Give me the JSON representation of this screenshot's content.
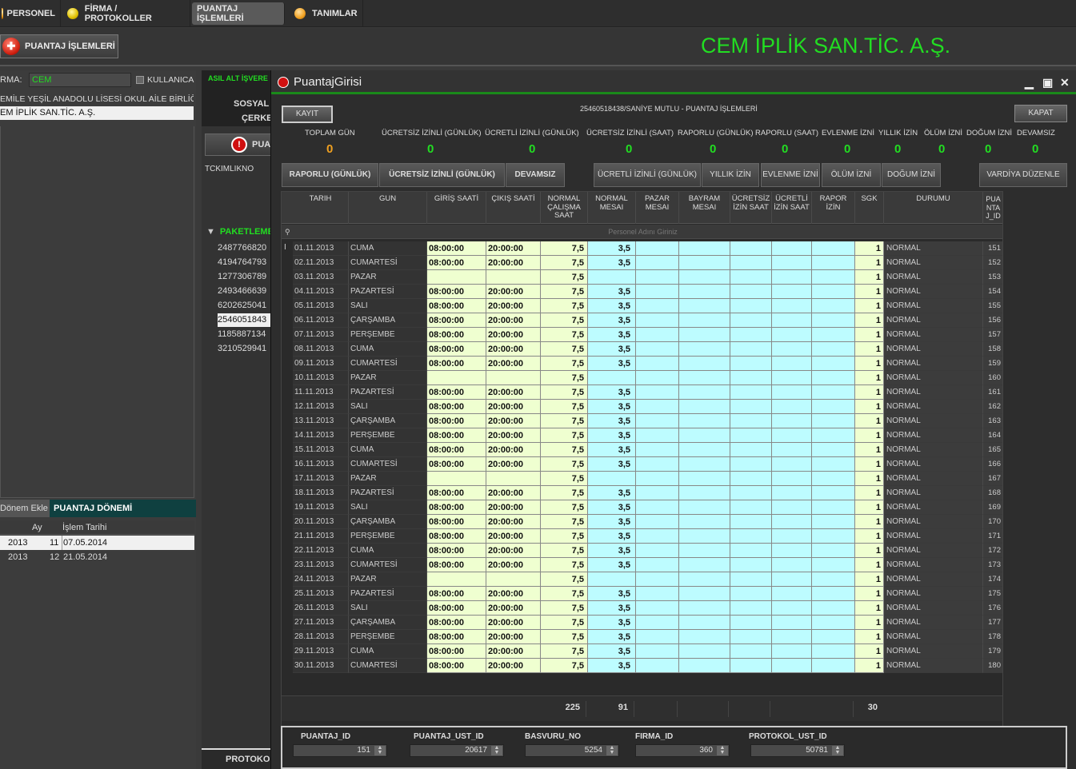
{
  "topbar": {
    "tabs": [
      {
        "label": "PERSONEL",
        "icon": "orange-dot-icon"
      },
      {
        "label": "FİRMA / PROTOKOLLER",
        "icon": "yellow-dot-icon"
      },
      {
        "label": "PUANTAJ İŞLEMLERİ",
        "active": true
      },
      {
        "label": "TANIMLAR",
        "icon": "orange-dot-icon"
      }
    ]
  },
  "subbar": {
    "main_button": "PUANTAJ İŞLEMLERİ",
    "company": "CEM İPLİK SAN.TİC. A.Ş."
  },
  "left": {
    "firma_label": "RMA:",
    "firma_value": "CEM",
    "kullanici_label": "KULLANICA",
    "firms": [
      "EMİLE YEŞİL ANADOLU LİSESİ OKUL AİLE BİRLİĞİ E",
      "EM İPLİK SAN.TİC. A.Ş."
    ],
    "donem_ekle": "Dönem Ekle",
    "donem_title": "PUANTAJ DÖNEMİ",
    "donem_headers": [
      "Ay",
      "İşlem Tarihi"
    ],
    "donem_rows": [
      {
        "yil": "2013",
        "ay": "11",
        "tarih": "07.05.2014"
      },
      {
        "yil": "2013",
        "ay": "12",
        "tarih": "21.05.2014"
      }
    ]
  },
  "mid": {
    "asil": "ASIL ALT İŞVERE",
    "sosyal": "SOSYAL",
    "cerke": "ÇERKE",
    "pua": "PUA",
    "tckimlikno": "TCKIMLIKNO",
    "paket": "PAKETLEME",
    "tc_list": [
      "2487766820",
      "4194764793",
      "1277306789",
      "2493466639",
      "6202625041",
      "2546051843",
      "1185887134",
      "3210529941"
    ],
    "protoko": "PROTOKO"
  },
  "modal": {
    "title": "PuantajGirisi",
    "kayit": "KAYIT",
    "kapat": "KAPAT",
    "subtitle": "25460518438/SANİYE  MUTLU - PUANTAJ İŞLEMLERİ",
    "stats": [
      {
        "label": "TOPLAM GÜN",
        "value": "0"
      },
      {
        "label": "ÜCRETSİZ İZİNLİ (GÜNLÜK)",
        "value": "0"
      },
      {
        "label": "ÜCRETLİ İZİNLİ (GÜNLÜK)",
        "value": "0"
      },
      {
        "label": "ÜCRETSİZ İZİNLİ (SAAT)",
        "value": "0"
      },
      {
        "label": "RAPORLU (GÜNLÜK)",
        "value": "0"
      },
      {
        "label": "RAPORLU (SAAT)",
        "value": "0"
      },
      {
        "label": "EVLENME İZNİ",
        "value": "0"
      },
      {
        "label": "YILLIK İZİN",
        "value": "0"
      },
      {
        "label": "ÖLÜM İZNİ",
        "value": "0"
      },
      {
        "label": "DOĞUM İZNİ",
        "value": "0"
      },
      {
        "label": "DEVAMSIZ",
        "value": "0"
      }
    ],
    "actions": [
      "RAPORLU (GÜNLÜK)",
      "ÜCRETSİZ İZİNLİ (GÜNLÜK)",
      "DEVAMSIZ",
      "ÜCRETLİ İZİNLİ (GÜNLÜK)",
      "YILLIK İZİN",
      "EVLENME İZNİ",
      "ÖLÜM İZNİ",
      "DOĞUM İZNİ",
      "VARDİYA DÜZENLE"
    ],
    "grid": {
      "headers": [
        "TARIH",
        "GUN",
        "GİRİŞ SAATİ",
        "ÇIKIŞ SAATİ",
        "NORMAL ÇALIŞMA SAAT",
        "NORMAL MESAI",
        "PAZAR MESAI",
        "BAYRAM MESAI",
        "ÜCRETSİZ İZİN SAAT",
        "ÜCRETLİ İZİN SAAT",
        "RAPOR İZİN",
        "SGK",
        "DURUMU",
        "PUA NTA J_ID"
      ],
      "filter_placeholder": "Personel Adını Giriniz",
      "rows": [
        {
          "tarih": "01.11.2013",
          "gun": "CUMA",
          "giris": "08:00:00",
          "cikis": "20:00:00",
          "normal": "7,5",
          "mesai": "3,5",
          "sgk": "1",
          "durum": "NORMAL",
          "id": "151"
        },
        {
          "tarih": "02.11.2013",
          "gun": "CUMARTESİ",
          "giris": "08:00:00",
          "cikis": "20:00:00",
          "normal": "7,5",
          "mesai": "3,5",
          "sgk": "1",
          "durum": "NORMAL",
          "id": "152"
        },
        {
          "tarih": "03.11.2013",
          "gun": "PAZAR",
          "giris": "",
          "cikis": "",
          "normal": "7,5",
          "mesai": "",
          "sgk": "1",
          "durum": "NORMAL",
          "id": "153"
        },
        {
          "tarih": "04.11.2013",
          "gun": "PAZARTESİ",
          "giris": "08:00:00",
          "cikis": "20:00:00",
          "normal": "7,5",
          "mesai": "3,5",
          "sgk": "1",
          "durum": "NORMAL",
          "id": "154"
        },
        {
          "tarih": "05.11.2013",
          "gun": "SALI",
          "giris": "08:00:00",
          "cikis": "20:00:00",
          "normal": "7,5",
          "mesai": "3,5",
          "sgk": "1",
          "durum": "NORMAL",
          "id": "155"
        },
        {
          "tarih": "06.11.2013",
          "gun": "ÇARŞAMBA",
          "giris": "08:00:00",
          "cikis": "20:00:00",
          "normal": "7,5",
          "mesai": "3,5",
          "sgk": "1",
          "durum": "NORMAL",
          "id": "156"
        },
        {
          "tarih": "07.11.2013",
          "gun": "PERŞEMBE",
          "giris": "08:00:00",
          "cikis": "20:00:00",
          "normal": "7,5",
          "mesai": "3,5",
          "sgk": "1",
          "durum": "NORMAL",
          "id": "157"
        },
        {
          "tarih": "08.11.2013",
          "gun": "CUMA",
          "giris": "08:00:00",
          "cikis": "20:00:00",
          "normal": "7,5",
          "mesai": "3,5",
          "sgk": "1",
          "durum": "NORMAL",
          "id": "158"
        },
        {
          "tarih": "09.11.2013",
          "gun": "CUMARTESİ",
          "giris": "08:00:00",
          "cikis": "20:00:00",
          "normal": "7,5",
          "mesai": "3,5",
          "sgk": "1",
          "durum": "NORMAL",
          "id": "159"
        },
        {
          "tarih": "10.11.2013",
          "gun": "PAZAR",
          "giris": "",
          "cikis": "",
          "normal": "7,5",
          "mesai": "",
          "sgk": "1",
          "durum": "NORMAL",
          "id": "160"
        },
        {
          "tarih": "11.11.2013",
          "gun": "PAZARTESİ",
          "giris": "08:00:00",
          "cikis": "20:00:00",
          "normal": "7,5",
          "mesai": "3,5",
          "sgk": "1",
          "durum": "NORMAL",
          "id": "161"
        },
        {
          "tarih": "12.11.2013",
          "gun": "SALI",
          "giris": "08:00:00",
          "cikis": "20:00:00",
          "normal": "7,5",
          "mesai": "3,5",
          "sgk": "1",
          "durum": "NORMAL",
          "id": "162"
        },
        {
          "tarih": "13.11.2013",
          "gun": "ÇARŞAMBA",
          "giris": "08:00:00",
          "cikis": "20:00:00",
          "normal": "7,5",
          "mesai": "3,5",
          "sgk": "1",
          "durum": "NORMAL",
          "id": "163"
        },
        {
          "tarih": "14.11.2013",
          "gun": "PERŞEMBE",
          "giris": "08:00:00",
          "cikis": "20:00:00",
          "normal": "7,5",
          "mesai": "3,5",
          "sgk": "1",
          "durum": "NORMAL",
          "id": "164"
        },
        {
          "tarih": "15.11.2013",
          "gun": "CUMA",
          "giris": "08:00:00",
          "cikis": "20:00:00",
          "normal": "7,5",
          "mesai": "3,5",
          "sgk": "1",
          "durum": "NORMAL",
          "id": "165"
        },
        {
          "tarih": "16.11.2013",
          "gun": "CUMARTESİ",
          "giris": "08:00:00",
          "cikis": "20:00:00",
          "normal": "7,5",
          "mesai": "3,5",
          "sgk": "1",
          "durum": "NORMAL",
          "id": "166"
        },
        {
          "tarih": "17.11.2013",
          "gun": "PAZAR",
          "giris": "",
          "cikis": "",
          "normal": "7,5",
          "mesai": "",
          "sgk": "1",
          "durum": "NORMAL",
          "id": "167"
        },
        {
          "tarih": "18.11.2013",
          "gun": "PAZARTESİ",
          "giris": "08:00:00",
          "cikis": "20:00:00",
          "normal": "7,5",
          "mesai": "3,5",
          "sgk": "1",
          "durum": "NORMAL",
          "id": "168"
        },
        {
          "tarih": "19.11.2013",
          "gun": "SALI",
          "giris": "08:00:00",
          "cikis": "20:00:00",
          "normal": "7,5",
          "mesai": "3,5",
          "sgk": "1",
          "durum": "NORMAL",
          "id": "169"
        },
        {
          "tarih": "20.11.2013",
          "gun": "ÇARŞAMBA",
          "giris": "08:00:00",
          "cikis": "20:00:00",
          "normal": "7,5",
          "mesai": "3,5",
          "sgk": "1",
          "durum": "NORMAL",
          "id": "170"
        },
        {
          "tarih": "21.11.2013",
          "gun": "PERŞEMBE",
          "giris": "08:00:00",
          "cikis": "20:00:00",
          "normal": "7,5",
          "mesai": "3,5",
          "sgk": "1",
          "durum": "NORMAL",
          "id": "171"
        },
        {
          "tarih": "22.11.2013",
          "gun": "CUMA",
          "giris": "08:00:00",
          "cikis": "20:00:00",
          "normal": "7,5",
          "mesai": "3,5",
          "sgk": "1",
          "durum": "NORMAL",
          "id": "172"
        },
        {
          "tarih": "23.11.2013",
          "gun": "CUMARTESİ",
          "giris": "08:00:00",
          "cikis": "20:00:00",
          "normal": "7,5",
          "mesai": "3,5",
          "sgk": "1",
          "durum": "NORMAL",
          "id": "173"
        },
        {
          "tarih": "24.11.2013",
          "gun": "PAZAR",
          "giris": "",
          "cikis": "",
          "normal": "7,5",
          "mesai": "",
          "sgk": "1",
          "durum": "NORMAL",
          "id": "174"
        },
        {
          "tarih": "25.11.2013",
          "gun": "PAZARTESİ",
          "giris": "08:00:00",
          "cikis": "20:00:00",
          "normal": "7,5",
          "mesai": "3,5",
          "sgk": "1",
          "durum": "NORMAL",
          "id": "175"
        },
        {
          "tarih": "26.11.2013",
          "gun": "SALI",
          "giris": "08:00:00",
          "cikis": "20:00:00",
          "normal": "7,5",
          "mesai": "3,5",
          "sgk": "1",
          "durum": "NORMAL",
          "id": "176"
        },
        {
          "tarih": "27.11.2013",
          "gun": "ÇARŞAMBA",
          "giris": "08:00:00",
          "cikis": "20:00:00",
          "normal": "7,5",
          "mesai": "3,5",
          "sgk": "1",
          "durum": "NORMAL",
          "id": "177"
        },
        {
          "tarih": "28.11.2013",
          "gun": "PERŞEMBE",
          "giris": "08:00:00",
          "cikis": "20:00:00",
          "normal": "7,5",
          "mesai": "3,5",
          "sgk": "1",
          "durum": "NORMAL",
          "id": "178"
        },
        {
          "tarih": "29.11.2013",
          "gun": "CUMA",
          "giris": "08:00:00",
          "cikis": "20:00:00",
          "normal": "7,5",
          "mesai": "3,5",
          "sgk": "1",
          "durum": "NORMAL",
          "id": "179"
        },
        {
          "tarih": "30.11.2013",
          "gun": "CUMARTESİ",
          "giris": "08:00:00",
          "cikis": "20:00:00",
          "normal": "7,5",
          "mesai": "3,5",
          "sgk": "1",
          "durum": "NORMAL",
          "id": "180"
        }
      ],
      "totals": {
        "normal": "225",
        "mesai": "91",
        "sgk": "30"
      }
    },
    "fields": [
      {
        "label": "PUANTAJ_ID",
        "value": "151"
      },
      {
        "label": "PUANTAJ_UST_ID",
        "value": "20617"
      },
      {
        "label": "BASVURU_NO",
        "value": "5254"
      },
      {
        "label": "FIRMA_ID",
        "value": "360"
      },
      {
        "label": "PROTOKOL_UST_ID",
        "value": "50781"
      }
    ]
  }
}
